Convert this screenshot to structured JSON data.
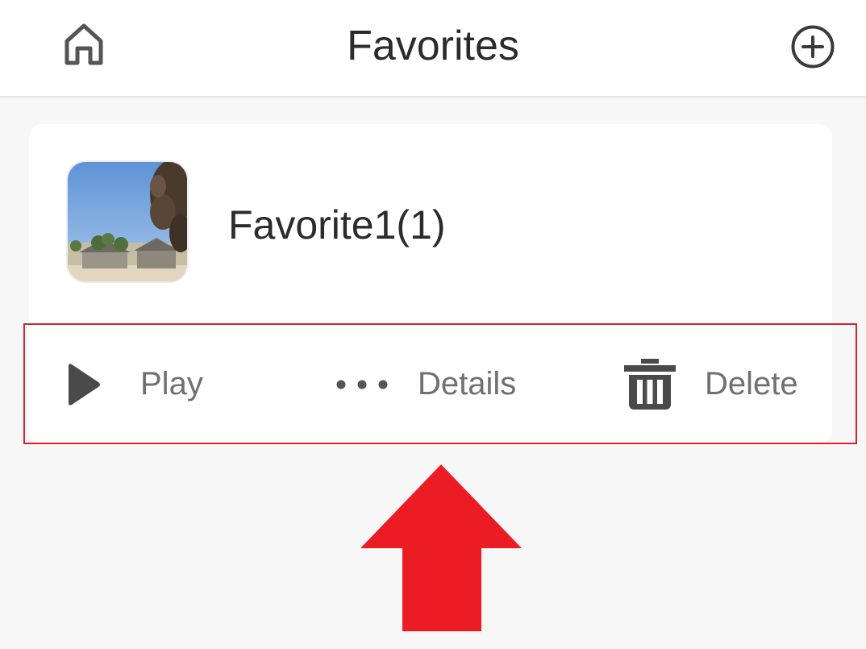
{
  "header": {
    "title": "Favorites",
    "home_icon": "home-icon",
    "add_icon": "plus-circle-icon"
  },
  "favorite": {
    "name": "Favorite1(1)",
    "thumbnail": "scene-thumbnail"
  },
  "actions": {
    "play_label": "Play",
    "details_label": "Details",
    "delete_label": "Delete"
  },
  "colors": {
    "highlight": "#d9212f",
    "arrow": "#ec1c24"
  }
}
